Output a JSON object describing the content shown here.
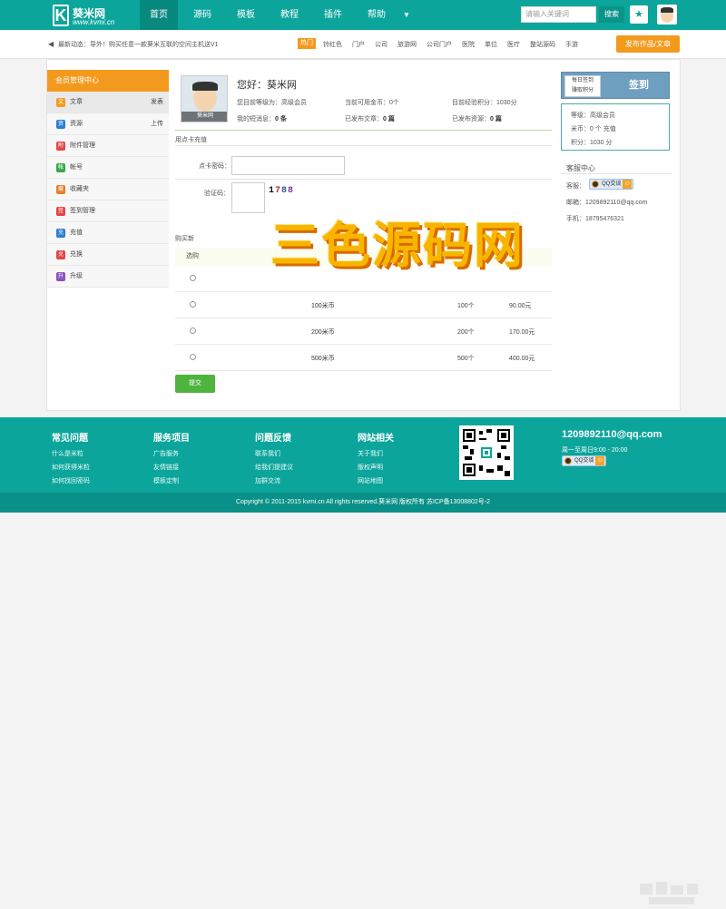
{
  "nav": {
    "logo_cn": "葵米网",
    "logo_en": "www.kvmi.cn",
    "logo_mark": "K",
    "items": [
      {
        "label": "首页"
      },
      {
        "label": "源码"
      },
      {
        "label": "模板"
      },
      {
        "label": "教程"
      },
      {
        "label": "插件"
      },
      {
        "label": "帮助"
      }
    ],
    "more_icon": "chevron-down-icon",
    "search_placeholder": "请输入关键词",
    "search_button": "搜索",
    "star_icon": "★"
  },
  "ticker": {
    "text": "最新动态：导外！购买任意一款葵米互联的空间主机送V1",
    "hot_label": "热门",
    "tags": [
      "铃红色",
      "门户",
      "公司",
      "旅游网",
      "公司门户",
      "医院",
      "单位",
      "医疗",
      "整站源码",
      "手游"
    ],
    "publish_button": "发布作品/文章"
  },
  "sidebar": {
    "title": "会员管理中心",
    "items": [
      {
        "label": "文章",
        "action": "发表",
        "icon": "article-icon",
        "color": "#f39a1e",
        "glyph": "文"
      },
      {
        "label": "资源",
        "action": "上传",
        "icon": "resource-icon",
        "color": "#2c7ed0",
        "glyph": "资"
      },
      {
        "label": "附件管理",
        "action": "",
        "icon": "attachment-icon",
        "color": "#e54545",
        "glyph": "附"
      },
      {
        "label": "帐号",
        "action": "",
        "icon": "account-icon",
        "color": "#3aa84a",
        "glyph": "帐"
      },
      {
        "label": "收藏夹",
        "action": "",
        "icon": "favorites-icon",
        "color": "#e87d2a",
        "glyph": "藏"
      },
      {
        "label": "签到管理",
        "action": "",
        "icon": "checkin-icon",
        "color": "#e54545",
        "glyph": "签"
      },
      {
        "label": "充值",
        "action": "",
        "icon": "recharge-icon",
        "color": "#2c7ed0",
        "glyph": "充"
      },
      {
        "label": "兑换",
        "action": "",
        "icon": "exchange-icon",
        "color": "#e54545",
        "glyph": "兑"
      },
      {
        "label": "升级",
        "action": "",
        "icon": "upgrade-icon",
        "color": "#8a52c0",
        "glyph": "升"
      }
    ]
  },
  "user": {
    "greeting": "您好：葵米网",
    "avatar_label": "葵米网",
    "level_label": "您目前等级为：",
    "level_value": "高级会员",
    "coins_label": "当前可用金币：",
    "coins_value": "0个",
    "points_label": "目前经验积分：",
    "points_value": "1030分",
    "msg_label": "我的短消息：",
    "msg_value": "0 条",
    "articles_label": "已发布文章：",
    "articles_value": "0 篇",
    "res_label": "已发布资源：",
    "res_value": "0 篇"
  },
  "recharge": {
    "section_title": "用点卡充值",
    "card_label": "点卡密码：",
    "card_value": "",
    "captcha_label": "验证码：",
    "captcha_value": "",
    "captcha": [
      "1",
      "7",
      "8",
      "8"
    ]
  },
  "buy": {
    "section_title": "购买新",
    "col_head": "选购",
    "rows": [
      {
        "name": "",
        "count": "",
        "price": ""
      },
      {
        "name": "100米币",
        "count": "100个",
        "price": "90.00元"
      },
      {
        "name": "200米币",
        "count": "200个",
        "price": "170.00元"
      },
      {
        "name": "500米币",
        "count": "500个",
        "price": "400.00元"
      }
    ],
    "submit": "提交"
  },
  "sign": {
    "daily_line1": "每日签到",
    "daily_line2": "赚取积分",
    "button": "签到",
    "level_label": "等级：",
    "level": "高级会员",
    "coins_label": "米币：",
    "coins": "0 个 充值",
    "points_label": "积分：",
    "points": "1030 分"
  },
  "service": {
    "title": "客服中心",
    "qq_label": "客服：",
    "qq_badge": "QQ交谈",
    "email_label": "邮箱：",
    "email": "1209892110@qq.com",
    "phone_label": "手机：",
    "phone": "18795476321"
  },
  "footer": {
    "cols": [
      {
        "title": "常见问题",
        "links": [
          "什么是米粒",
          "如何获得米粒",
          "如何找回密码"
        ]
      },
      {
        "title": "服务项目",
        "links": [
          "广告服务",
          "友情链接",
          "模板定制"
        ]
      },
      {
        "title": "问题反馈",
        "links": [
          "联系我们",
          "给我们提建议",
          "加群交流"
        ]
      },
      {
        "title": "网站相关",
        "links": [
          "关于我们",
          "版权声明",
          "网站地图"
        ]
      }
    ],
    "email": "1209892110@qq.com",
    "hours": "周一至周日9:00 - 20:00",
    "qq_badge": "QQ交谈",
    "copyright": "Copyright © 2011-2015 kvmi.cn All rights reserved.葵米网 版权所有  苏ICP备13008802号-2"
  },
  "watermark": "三色源码网",
  "colors": {
    "primary": "#0ca59b",
    "accent": "#f39a1e",
    "submit": "#4fb43e"
  }
}
